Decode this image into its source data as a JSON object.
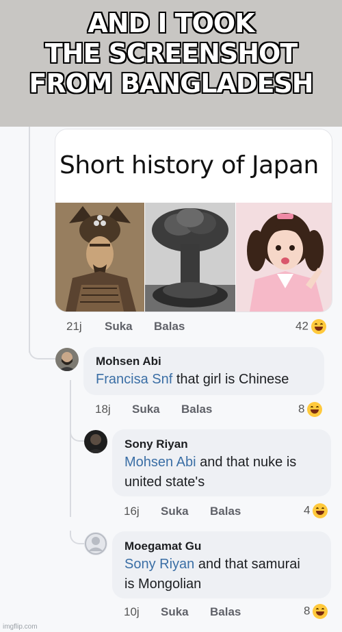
{
  "caption": {
    "lines": [
      "AND I TOOK",
      "THE SCREENSHOT",
      "FROM BANGLADESH"
    ]
  },
  "post": {
    "title": "Short history of Japan",
    "time": "21j",
    "like_label": "Suka",
    "reply_label": "Balas",
    "reaction_count": "42"
  },
  "comments": [
    {
      "author": "Mohsen Abi",
      "mention": "Francisa Snf",
      "text": " that girl is Chinese",
      "time": "18j",
      "like_label": "Suka",
      "reply_label": "Balas",
      "reaction_count": "8"
    },
    {
      "author": "Sony Riyan",
      "mention": "Mohsen Abi",
      "text_line1": " and that nuke is",
      "text_line2": "united state's",
      "time": "16j",
      "like_label": "Suka",
      "reply_label": "Balas",
      "reaction_count": "4"
    },
    {
      "author": "Moegamat Gu",
      "mention": "Sony Riyan",
      "text_line1": " and that samurai",
      "text_line2": "is Mongolian",
      "time": "10j",
      "like_label": "Suka",
      "reply_label": "Balas",
      "reaction_count": "8"
    }
  ],
  "watermark": "imgflip.com",
  "icons": {
    "reaction": "laughing-emoji-icon",
    "default_avatar": "default-user-avatar-icon"
  },
  "colors": {
    "caption_bg": "#c8c6c3",
    "mention": "#3a6ea5",
    "bubble_bg": "#eef0f4",
    "reaction_yellow": "#ffc93c"
  }
}
